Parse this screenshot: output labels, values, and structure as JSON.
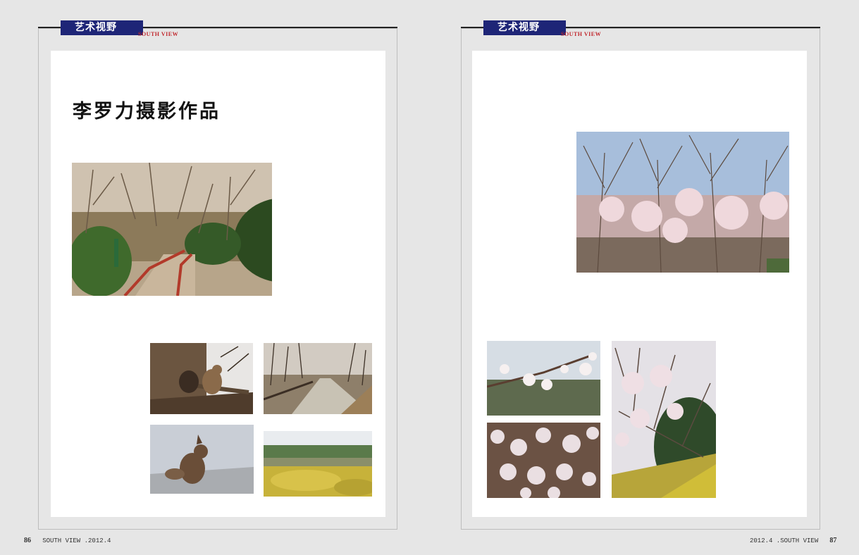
{
  "left_page": {
    "section_tag": "艺术视野",
    "section_sub": "SOUTH VIEW",
    "title": "李罗力摄影作品",
    "page_number": "86",
    "footer_text": "SOUTH VIEW .2012.4"
  },
  "right_page": {
    "section_tag": "艺术视野",
    "section_sub": "SOUTH VIEW",
    "page_number": "87",
    "footer_text": "2012.4 .SOUTH VIEW"
  },
  "colors": {
    "tag_bg": "#1e2577",
    "tag_sub": "#c0282d"
  }
}
